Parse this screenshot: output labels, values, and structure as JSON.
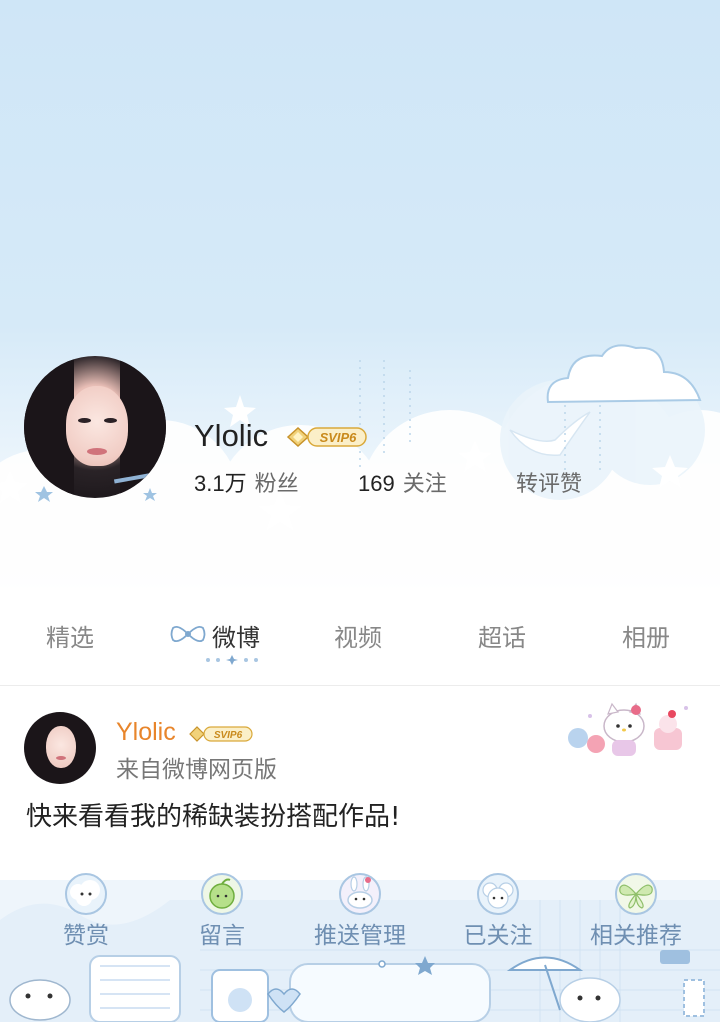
{
  "profile": {
    "username": "Ylolic",
    "vip_badge": "SVIP6",
    "fans_count": "3.1万",
    "fans_label": "粉丝",
    "follow_count": "169",
    "follow_label": "关注",
    "repost_comment_like_label": "转评赞"
  },
  "tabs": [
    {
      "label": "精选"
    },
    {
      "label": "微博"
    },
    {
      "label": "视频"
    },
    {
      "label": "超话"
    },
    {
      "label": "相册"
    }
  ],
  "active_tab": "微博",
  "post": {
    "author": "Ylolic",
    "vip_badge": "SVIP6",
    "source": "来自微博网页版",
    "text": "快来看看我的稀缺装扮搭配作品!"
  },
  "actions": [
    {
      "label": "赞赏",
      "icon": "cloud-bear-icon"
    },
    {
      "label": "留言",
      "icon": "apple-icon"
    },
    {
      "label": "推送管理",
      "icon": "bunny-cake-icon"
    },
    {
      "label": "已关注",
      "icon": "cloud-sheep-icon"
    },
    {
      "label": "相关推荐",
      "icon": "butterfly-icon"
    }
  ],
  "colors": {
    "sky": "#cfe6f7",
    "author_orange": "#e8852b",
    "action_blue": "#6f8fb2",
    "vip_gold": "#d9a93a"
  }
}
